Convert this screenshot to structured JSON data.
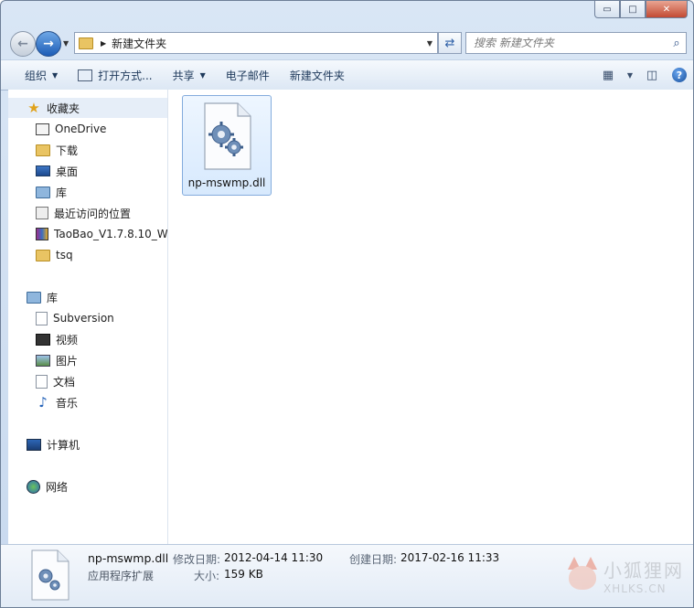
{
  "window": {
    "caption_buttons": [
      "▭",
      "□",
      "✕"
    ]
  },
  "address": {
    "path": "新建文件夹",
    "search_placeholder": "搜索 新建文件夹"
  },
  "toolbar": {
    "organize": "组织",
    "open_with": "打开方式...",
    "share": "共享",
    "email": "电子邮件",
    "new_folder": "新建文件夹"
  },
  "nav": {
    "favorites": {
      "label": "收藏夹",
      "items": [
        {
          "label": "OneDrive",
          "icon": "onedrive-icon"
        },
        {
          "label": "下载",
          "icon": "download-folder-icon"
        },
        {
          "label": "桌面",
          "icon": "desktop-icon"
        },
        {
          "label": "库",
          "icon": "library-icon"
        },
        {
          "label": "最近访问的位置",
          "icon": "recent-places-icon"
        },
        {
          "label": "TaoBao_V1.7.8.10_Wi",
          "icon": "archive-icon"
        },
        {
          "label": "tsq",
          "icon": "folder-icon"
        }
      ]
    },
    "libraries": {
      "label": "库",
      "items": [
        {
          "label": "Subversion",
          "icon": "document-library-icon"
        },
        {
          "label": "视频",
          "icon": "video-icon"
        },
        {
          "label": "图片",
          "icon": "picture-icon"
        },
        {
          "label": "文档",
          "icon": "document-icon"
        },
        {
          "label": "音乐",
          "icon": "music-icon"
        }
      ]
    },
    "computer": {
      "label": "计算机"
    },
    "network": {
      "label": "网络"
    }
  },
  "files": [
    {
      "name": "np-mswmp.dll",
      "icon": "dll-file-icon",
      "selected": true
    }
  ],
  "details": {
    "name": "np-mswmp.dll",
    "type": "应用程序扩展",
    "modified_label": "修改日期:",
    "modified_value": "2012-04-14 11:30",
    "created_label": "创建日期:",
    "created_value": "2017-02-16 11:33",
    "size_label": "大小:",
    "size_value": "159 KB"
  },
  "watermark": {
    "cn": "小狐狸网",
    "en": "XHLKS.CN"
  }
}
